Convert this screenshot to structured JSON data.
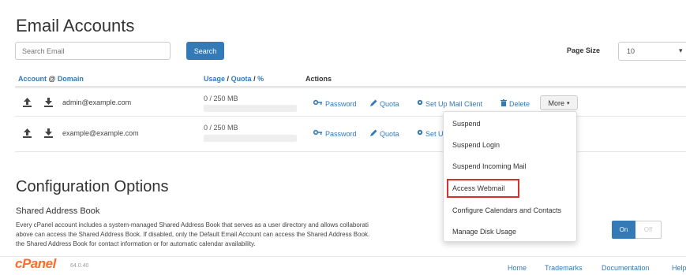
{
  "header": {
    "title": "Email Accounts"
  },
  "search": {
    "placeholder": "Search Email",
    "button_label": "Search"
  },
  "page_size": {
    "label": "Page Size",
    "value": "10",
    "arrow": "▾"
  },
  "columns": {
    "account": "Account",
    "at_symbol": "@",
    "domain": "Domain",
    "usage": "Usage",
    "quota": "Quota",
    "percent": "%",
    "slash": "/",
    "actions": "Actions"
  },
  "rows": [
    {
      "email": "admin@example.com",
      "usage": "0 / 250 MB"
    },
    {
      "email": "example@example.com",
      "usage": "0 / 250 MB"
    }
  ],
  "actions": {
    "password": "Password",
    "quota": "Quota",
    "setup": "Set Up Mail Client",
    "setup_truncated": "Set U",
    "delete": "Delete",
    "more": "More"
  },
  "icons": {
    "upload": "upload-icon",
    "download": "download-icon",
    "key": "key-icon",
    "pencil": "pencil-icon",
    "gear": "gear-icon",
    "trash": "trash-icon",
    "caret": "caret-down-icon"
  },
  "dropdown": {
    "items": [
      "Suspend",
      "Suspend Login",
      "Suspend Incoming Mail",
      "Access Webmail",
      "Configure Calendars and Contacts",
      "Manage Disk Usage"
    ],
    "highlighted": "Access Webmail"
  },
  "config": {
    "title": "Configuration Options",
    "section": "Shared Address Book",
    "desc_line1": "Every cPanel account includes a system-managed Shared Address Book that serves as a user directory and allows collaborati",
    "desc_line2": "above can access the Shared Address Book. If disabled, only the Default Email Account can access the Shared Address Book.",
    "desc_line3": "the Shared Address Book for contact information or for automatic calendar availability.",
    "toggle_on": "On",
    "toggle_off": "Off"
  },
  "footer": {
    "logo": "cPanel",
    "version": "64.0.40",
    "links": [
      "Home",
      "Trademarks",
      "Documentation",
      "Help"
    ]
  },
  "colors": {
    "accent": "#337ab7",
    "brand": "#ff6c2c",
    "highlight_border": "#d9302c"
  }
}
